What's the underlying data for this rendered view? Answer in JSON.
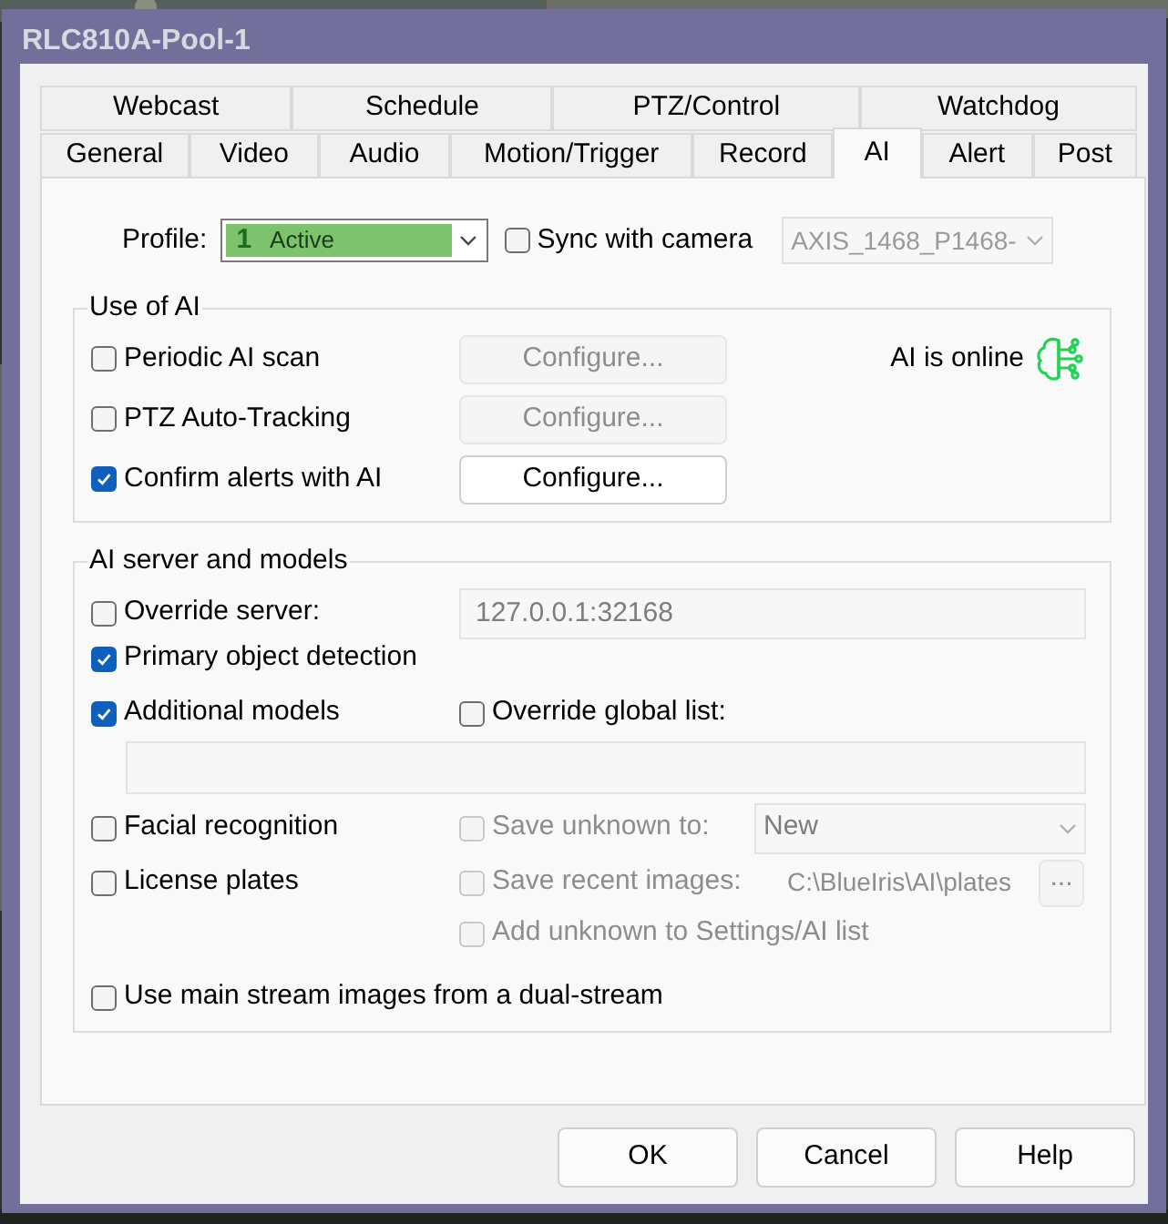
{
  "window": {
    "title": "RLC810A-Pool-1"
  },
  "tabs": [
    [
      {
        "label": "Webcast",
        "selected": false
      },
      {
        "label": "Schedule",
        "selected": false
      },
      {
        "label": "PTZ/Control",
        "selected": false
      },
      {
        "label": "Watchdog",
        "selected": false
      }
    ],
    [
      {
        "label": "General",
        "selected": false
      },
      {
        "label": "Video",
        "selected": false
      },
      {
        "label": "Audio",
        "selected": false
      },
      {
        "label": "Motion/Trigger",
        "selected": false
      },
      {
        "label": "Record",
        "selected": false
      },
      {
        "label": "AI",
        "selected": true
      },
      {
        "label": "Alert",
        "selected": false
      },
      {
        "label": "Post",
        "selected": false
      }
    ]
  ],
  "profile": {
    "label": "Profile:",
    "number": "1",
    "value": "Active"
  },
  "sync": {
    "label": "Sync with camera",
    "checked": false
  },
  "camera_select": {
    "value": "AXIS_1468_P1468-",
    "disabled": true
  },
  "use_of_ai": {
    "title": "Use of AI",
    "status": "AI is online",
    "options": [
      {
        "label": "Periodic AI scan",
        "checked": false,
        "button": {
          "label": "Configure...",
          "disabled": true
        }
      },
      {
        "label": "PTZ Auto-Tracking",
        "checked": false,
        "button": {
          "label": "Configure...",
          "disabled": true
        }
      },
      {
        "label": "Confirm alerts with AI",
        "checked": true,
        "button": {
          "label": "Configure...",
          "disabled": false
        }
      }
    ]
  },
  "ai_server": {
    "title": "AI server and models",
    "override_server": {
      "label": "Override server:",
      "checked": false
    },
    "server_field": {
      "value": "127.0.0.1:32168",
      "disabled": true
    },
    "primary_detection": {
      "label": "Primary object detection",
      "checked": true
    },
    "additional_models": {
      "label": "Additional models",
      "checked": true
    },
    "override_global_list": {
      "label": "Override global list:",
      "checked": false
    },
    "facial_recognition": {
      "label": "Facial recognition",
      "checked": false
    },
    "save_unknown": {
      "label": "Save unknown to:",
      "checked": false,
      "disabled": true
    },
    "save_unknown_select": {
      "value": "New",
      "disabled": true
    },
    "license_plates": {
      "label": "License plates",
      "checked": false
    },
    "save_recent": {
      "label": "Save recent images:",
      "checked": false,
      "disabled": true
    },
    "plates_path": {
      "value": "C:\\BlueIris\\AI\\plates",
      "disabled": true
    },
    "browse_button": {
      "label": "...",
      "disabled": true
    },
    "add_unknown": {
      "label": "Add unknown to Settings/AI list",
      "checked": false,
      "disabled": true
    },
    "main_stream": {
      "label": "Use main stream images from a dual-stream",
      "checked": false
    }
  },
  "buttons": [
    "OK",
    "Cancel",
    "Help"
  ]
}
